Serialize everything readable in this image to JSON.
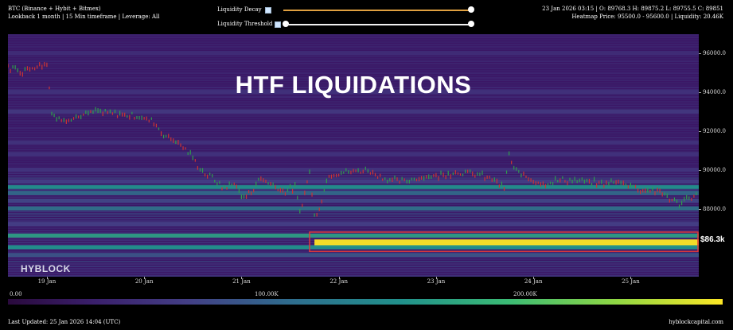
{
  "header": {
    "symbol_line": "BTC (Binance + Hybit + Bitmex)",
    "lookback_line": "Lookback 1 month | 15 Min timeframe | Leverage: All",
    "decay_label": "Liquidity Decay",
    "threshold_label": "Liquidity Threshold",
    "decay_level": 1.0,
    "threshold_level": 1.0,
    "ohlc_line": "23 Jan 2026 03:15 | O: 89768.3 H: 89875.2 L: 89755.5 C: 89851",
    "heatmap_line": "Heatmap Price: 95500.0 - 95600.0 | Liquidity: 20.46K"
  },
  "overlay": {
    "title": "HTF LIQUIDATIONS",
    "brand": "HYBLOCK",
    "price_tag": "$86.3k"
  },
  "colors": {
    "background": "#000000",
    "heatmap_low": "#3a1a66",
    "heatmap_mid": "#21918c",
    "heatmap_high": "#fde725",
    "candle_up": "#2e9e4a",
    "candle_down": "#cc3333",
    "highlight_box": "#e23a3a",
    "slider_track": "#e0a040"
  },
  "colorbar": {
    "labels": [
      "0.00",
      "100.00K",
      "200.00K"
    ]
  },
  "footer": {
    "last_updated": "Last Updated: 25 Jan 2026 14:04 (UTC)",
    "site": "hyblockcapital.com"
  },
  "chart_data": {
    "type": "heatmap",
    "title": "HTF LIQUIDATIONS",
    "x_ticks": [
      "19 Jan",
      "20 Jan",
      "21 Jan",
      "22 Jan",
      "23 Jan",
      "24 Jan",
      "25 Jan"
    ],
    "y_ticks": [
      "96000.0",
      "94000.0",
      "92000.0",
      "90000.0",
      "88000.0"
    ],
    "ylim": [
      84500,
      97000
    ],
    "xlim_days": [
      18.6,
      25.7
    ],
    "price_series": {
      "name": "BTC",
      "x_days": [
        18.6,
        18.75,
        18.9,
        19.0,
        19.05,
        19.1,
        19.3,
        19.5,
        19.7,
        19.9,
        20.1,
        20.2,
        20.3,
        20.4,
        20.5,
        20.6,
        20.7,
        20.8,
        20.95,
        21.0,
        21.1,
        21.2,
        21.3,
        21.45,
        21.55,
        21.6,
        21.7,
        21.75,
        21.8,
        21.9,
        22.1,
        22.3,
        22.5,
        22.7,
        22.8,
        23.0,
        23.2,
        23.4,
        23.6,
        23.7,
        23.75,
        23.8,
        23.95,
        24.1,
        24.3,
        24.5,
        24.7,
        24.9,
        25.1,
        25.3,
        25.5,
        25.6,
        25.7
      ],
      "close": [
        95300,
        95100,
        95400,
        95500,
        93000,
        92600,
        92700,
        93000,
        92900,
        92800,
        92500,
        91800,
        91600,
        91200,
        90600,
        89900,
        89600,
        89100,
        89300,
        88500,
        88900,
        89600,
        89300,
        88900,
        89100,
        87800,
        89900,
        87600,
        88100,
        89800,
        89900,
        90000,
        89500,
        89400,
        89600,
        89700,
        89900,
        89800,
        89500,
        89000,
        90800,
        90000,
        89600,
        89300,
        89500,
        89400,
        89300,
        89400,
        89000,
        88900,
        88200,
        88600,
        88700
      ]
    },
    "liquidity_bands": [
      {
        "price": 86300,
        "start_day": 21.75,
        "intensity": 1.0
      },
      {
        "price": 86600,
        "start_day": 18.6,
        "intensity": 0.55
      },
      {
        "price": 86000,
        "start_day": 18.6,
        "intensity": 0.5
      },
      {
        "price": 85600,
        "start_day": 18.6,
        "intensity": 0.35
      },
      {
        "price": 87200,
        "start_day": 18.6,
        "intensity": 0.3
      },
      {
        "price": 88000,
        "start_day": 18.6,
        "intensity": 0.42
      },
      {
        "price": 88400,
        "start_day": 18.6,
        "intensity": 0.32
      },
      {
        "price": 88800,
        "start_day": 18.6,
        "intensity": 0.4
      },
      {
        "price": 89100,
        "start_day": 18.6,
        "intensity": 0.5
      },
      {
        "price": 89400,
        "start_day": 18.6,
        "intensity": 0.3
      },
      {
        "price": 90000,
        "start_day": 18.6,
        "intensity": 0.22
      },
      {
        "price": 90800,
        "start_day": 18.6,
        "intensity": 0.2
      },
      {
        "price": 91400,
        "start_day": 18.6,
        "intensity": 0.2
      },
      {
        "price": 93000,
        "start_day": 18.6,
        "intensity": 0.25
      },
      {
        "price": 94000,
        "start_day": 18.6,
        "intensity": 0.2
      },
      {
        "price": 96000,
        "start_day": 18.6,
        "intensity": 0.15
      }
    ],
    "highlight": {
      "price_low": 85800,
      "price_high": 86800,
      "start_day": 21.7
    }
  }
}
